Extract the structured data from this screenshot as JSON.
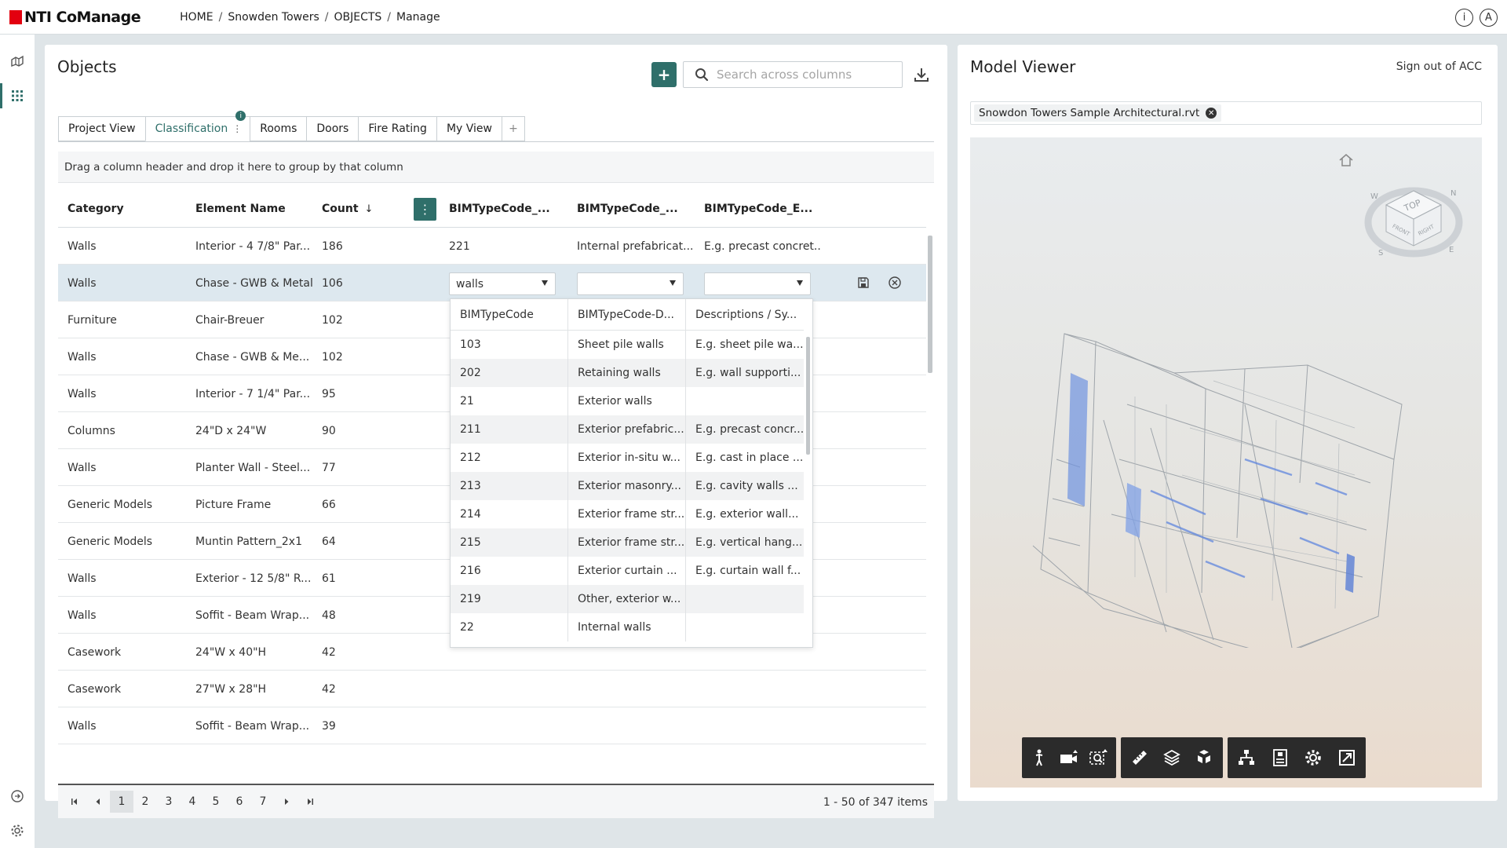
{
  "app": {
    "logo_text": "NTI CoManage",
    "colors": {
      "accent": "#2f6f6a",
      "brand_red": "#e3000f",
      "selected_row": "#dde8ef"
    }
  },
  "breadcrumb": [
    "HOME",
    "Snowden Towers",
    "OBJECTS",
    "Manage"
  ],
  "top_right_icons": [
    "info-icon",
    "account-icon"
  ],
  "rail_icons": [
    "home-map-icon",
    "apps-grid-icon",
    "play-circle-icon",
    "settings-icon"
  ],
  "objects": {
    "title": "Objects",
    "add_icon": "+",
    "search_placeholder": "Search across columns",
    "tabs": [
      {
        "label": "Project View"
      },
      {
        "label": "Classification",
        "badge": "i"
      },
      {
        "label": "Rooms"
      },
      {
        "label": "Doors"
      },
      {
        "label": "Fire Rating"
      },
      {
        "label": "My View"
      },
      {
        "label": "+"
      }
    ],
    "group_hint": "Drag a column header and drop it here to group by that column",
    "columns": [
      "Category",
      "Element Name",
      "Count",
      "BIMTypeCode_...",
      "BIMTypeCode_...",
      "BIMTypeCode_E..."
    ],
    "count_sort": "↓",
    "rows": [
      {
        "category": "Walls",
        "name": "Interior - 4 7/8\" Par...",
        "count": "186",
        "b1": "221",
        "b2": "Internal prefabricat...",
        "b3": "E.g. precast concret..."
      },
      {
        "category": "Walls",
        "name": "Chase - GWB & Metal S",
        "count": "106",
        "b1": "",
        "b2": "",
        "b3": ""
      },
      {
        "category": "Furniture",
        "name": "Chair-Breuer",
        "count": "102",
        "b1": "",
        "b2": "",
        "b3": ""
      },
      {
        "category": "Walls",
        "name": "Chase - GWB & Me...",
        "count": "102",
        "b1": "",
        "b2": "",
        "b3": ""
      },
      {
        "category": "Walls",
        "name": "Interior - 7 1/4\" Par...",
        "count": "95",
        "b1": "",
        "b2": "",
        "b3": ""
      },
      {
        "category": "Columns",
        "name": "24\"D x 24\"W",
        "count": "90",
        "b1": "",
        "b2": "",
        "b3": ""
      },
      {
        "category": "Walls",
        "name": "Planter Wall - Steel...",
        "count": "77",
        "b1": "",
        "b2": "",
        "b3": ""
      },
      {
        "category": "Generic Models",
        "name": "Picture Frame",
        "count": "66",
        "b1": "",
        "b2": "",
        "b3": ""
      },
      {
        "category": "Generic Models",
        "name": "Muntin Pattern_2x1",
        "count": "64",
        "b1": "",
        "b2": "",
        "b3": ""
      },
      {
        "category": "Walls",
        "name": "Exterior - 12 5/8\" R...",
        "count": "61",
        "b1": "",
        "b2": "",
        "b3": ""
      },
      {
        "category": "Walls",
        "name": "Soffit - Beam Wrap...",
        "count": "48",
        "b1": "",
        "b2": "",
        "b3": ""
      },
      {
        "category": "Casework",
        "name": "24\"W x 40\"H",
        "count": "42",
        "b1": "",
        "b2": "",
        "b3": ""
      },
      {
        "category": "Casework",
        "name": "27\"W x 28\"H",
        "count": "42",
        "b1": "",
        "b2": "",
        "b3": ""
      },
      {
        "category": "Walls",
        "name": "Soffit - Beam Wrap...",
        "count": "39",
        "b1": "",
        "b2": "",
        "b3": ""
      }
    ],
    "editor": {
      "combo1_value": "walls",
      "combo2_value": "",
      "combo3_value": ""
    },
    "dropdown": {
      "columns": [
        "BIMTypeCode",
        "BIMTypeCode-D...",
        "Descriptions / Sy..."
      ],
      "rows": [
        {
          "code": "103",
          "desc": "Sheet pile walls",
          "syn": "E.g. sheet pile wa..."
        },
        {
          "code": "202",
          "desc": "Retaining walls",
          "syn": "E.g. wall supporti..."
        },
        {
          "code": "21",
          "desc": "Exterior walls",
          "syn": ""
        },
        {
          "code": "211",
          "desc": "Exterior prefabric...",
          "syn": "E.g. precast concr..."
        },
        {
          "code": "212",
          "desc": "Exterior in-situ w...",
          "syn": "E.g. cast in place ..."
        },
        {
          "code": "213",
          "desc": "Exterior masonry...",
          "syn": "E.g. cavity walls ..."
        },
        {
          "code": "214",
          "desc": "Exterior frame str...",
          "syn": "E.g. exterior wall..."
        },
        {
          "code": "215",
          "desc": "Exterior frame str...",
          "syn": "E.g. vertical hang..."
        },
        {
          "code": "216",
          "desc": "Exterior curtain ...",
          "syn": "E.g. curtain wall f..."
        },
        {
          "code": "219",
          "desc": "Other, exterior w...",
          "syn": ""
        },
        {
          "code": "22",
          "desc": "Internal walls",
          "syn": ""
        }
      ]
    },
    "pager": {
      "pages": [
        "1",
        "2",
        "3",
        "4",
        "5",
        "6",
        "7"
      ],
      "active_page": "1",
      "info": "1 - 50 of 347 items"
    }
  },
  "viewer": {
    "title": "Model Viewer",
    "sign_out": "Sign out of ACC",
    "model_file": "Snowdon Towers Sample Architectural.rvt",
    "viewcube": {
      "top": "TOP",
      "front": "FRONT",
      "right": "RIGHT",
      "n": "N",
      "w": "W",
      "s": "S",
      "e": "E"
    },
    "toolbar_groups": [
      [
        "walk-person-icon",
        "camera-icon",
        "zoom-fit-icon"
      ],
      [
        "measure-ruler-icon",
        "layers-icon",
        "explode-model-icon"
      ],
      [
        "model-tree-icon",
        "properties-icon",
        "settings-gear-icon",
        "fullscreen-icon"
      ]
    ]
  }
}
